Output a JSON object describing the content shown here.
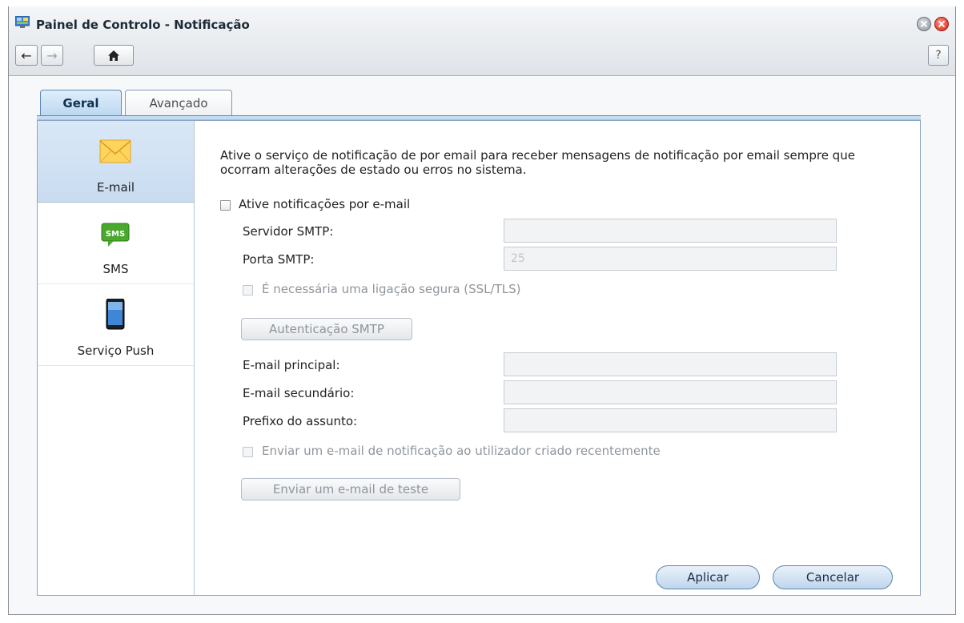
{
  "window": {
    "title": "Painel de Controlo - Notificação"
  },
  "toolbar": {
    "back_icon": "←",
    "forward_icon": "→",
    "home_icon": "⌂",
    "help_label": "?"
  },
  "tabs": [
    {
      "label": "Geral",
      "active": true
    },
    {
      "label": "Avançado",
      "active": false
    }
  ],
  "sidebar": {
    "items": [
      {
        "label": "E-mail",
        "icon": "envelope-icon",
        "selected": true
      },
      {
        "label": "SMS",
        "icon": "sms-icon",
        "selected": false
      },
      {
        "label": "Serviço Push",
        "icon": "smartphone-icon",
        "selected": false
      }
    ]
  },
  "email": {
    "description": "Ative o serviço de notificação de por email para receber mensagens de notificação por email sempre que ocorram alterações de estado ou erros no sistema.",
    "enable_label": "Ative notificações por e-mail",
    "enable_checked": false,
    "smtp_server_label": "Servidor SMTP:",
    "smtp_server_value": "",
    "smtp_port_label": "Porta SMTP:",
    "smtp_port_value": "25",
    "secure_label": "É necessária uma ligação segura (SSL/TLS)",
    "auth_button": "Autenticação SMTP",
    "primary_label": "E-mail principal:",
    "primary_value": "",
    "secondary_label": "E-mail secundário:",
    "secondary_value": "",
    "prefix_label": "Prefixo do assunto:",
    "prefix_value": "",
    "notify_new_user_label": "Enviar um e-mail de notificação ao utilizador criado recentemente",
    "test_button": "Enviar um e-mail de teste"
  },
  "actions": {
    "apply": "Aplicar",
    "cancel": "Cancelar"
  },
  "colors": {
    "accent": "#5d88b3",
    "selected_bg": "#d9e8f7",
    "close_button": "#d8261a"
  }
}
